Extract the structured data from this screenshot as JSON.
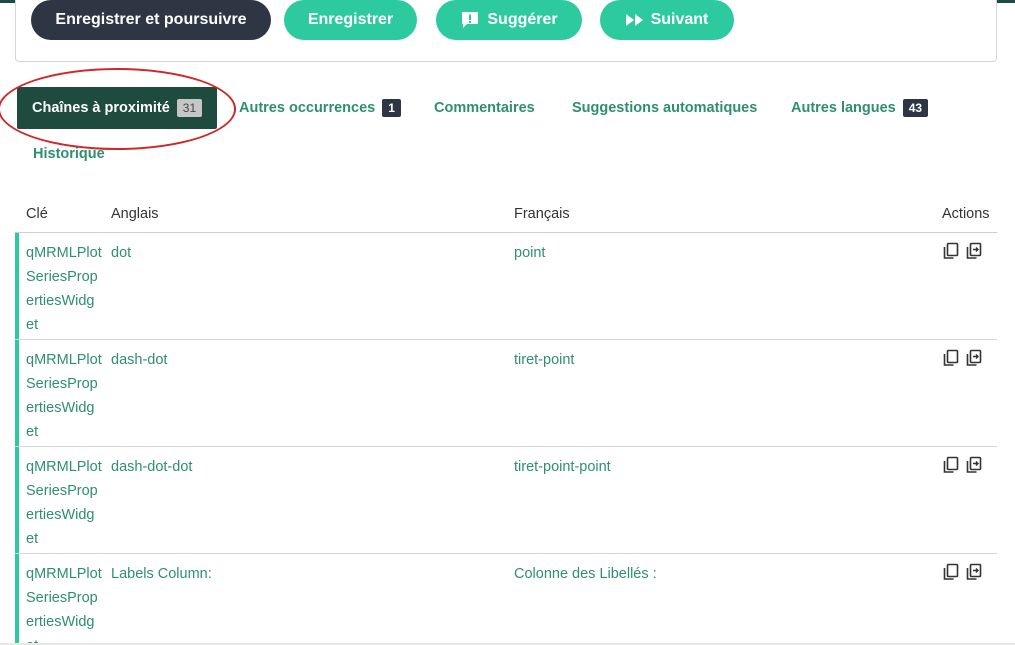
{
  "toolbar": {
    "save_continue": "Enregistrer et poursuivre",
    "save": "Enregistrer",
    "suggest": "Suggérer",
    "next": "Suivant"
  },
  "tabs": [
    {
      "label": "Chaînes à proximité",
      "count": "31",
      "active": true
    },
    {
      "label": "Autres occurrences",
      "count": "1"
    },
    {
      "label": "Commentaires"
    },
    {
      "label": "Suggestions automatiques"
    },
    {
      "label": "Autres langues",
      "count": "43"
    },
    {
      "label": "Historique"
    }
  ],
  "table": {
    "headers": {
      "key": "Clé",
      "source": "Anglais",
      "target": "Français",
      "actions": "Actions"
    },
    "rows": [
      {
        "key": "qMRMLPlotSeriesPropertiesWidget",
        "source": "dot",
        "target": "point"
      },
      {
        "key": "qMRMLPlotSeriesPropertiesWidget",
        "source": "dash-dot",
        "target": "tiret-point"
      },
      {
        "key": "qMRMLPlotSeriesPropertiesWidget",
        "source": "dash-dot-dot",
        "target": "tiret-point-point"
      },
      {
        "key": "qMRMLPlotSeriesPropertiesWidget",
        "source": "Labels Column:",
        "target": "Colonne des Libellés :"
      }
    ]
  },
  "colors": {
    "accent": "#2eca9f",
    "dark": "#2d3642",
    "active_tab": "#1f4b3f",
    "link": "#2f8f6f",
    "highlight": "#d02828"
  },
  "icons": {
    "suggest": "suggest-icon",
    "next": "fast-forward-icon",
    "copy": "copy-icon",
    "clone": "clone-icon"
  }
}
